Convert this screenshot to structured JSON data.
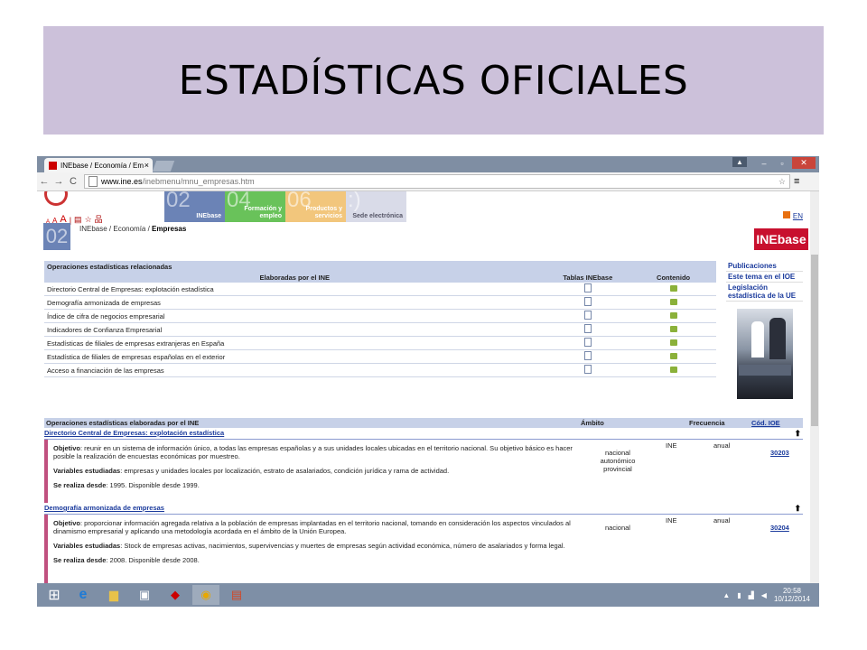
{
  "slide": {
    "title": "ESTADÍSTICAS OFICIALES"
  },
  "browser": {
    "tab_title": "INEbase / Economía / Em",
    "tab_close": "×",
    "url_host": "www.ine.es",
    "url_path": "/inebmenu/mnu_empresas.htm",
    "win_min": "–",
    "win_max": "▫",
    "win_close": "✕",
    "user": "▲",
    "back": "←",
    "forward": "→",
    "reload": "C",
    "star": "☆",
    "menu": "≡"
  },
  "site": {
    "sizes": [
      "A",
      "A",
      "A"
    ],
    "sections": [
      {
        "num": "02",
        "label": "INEbase"
      },
      {
        "num": "04",
        "label": "Formación y empleo"
      },
      {
        "num": "06",
        "label": "Productos y servicios"
      },
      {
        "num": ":)",
        "label": "Sede electrónica"
      }
    ],
    "lang": "EN",
    "crumb_num": "02",
    "breadcrumb_prefix": "INEbase / Economía / ",
    "breadcrumb_current": "Empresas",
    "logo": "INEbase"
  },
  "related": {
    "title": "Operaciones estadísticas relacionadas",
    "col_made_by": "Elaboradas por el INE",
    "col_tables": "Tablas INEbase",
    "col_content": "Contenido",
    "rows": [
      "Directorio Central de Empresas: explotación estadística",
      "Demografía armonizada de empresas",
      "Índice de cifra de negocios empresarial",
      "Indicadores de Confianza Empresarial",
      "Estadísticas de filiales de empresas extranjeras en España",
      "Estadística de filiales de empresas españolas en el exterior",
      "Acceso a financiación de las empresas"
    ]
  },
  "sidebar": {
    "links": [
      "Publicaciones",
      "Este tema en el IOE",
      "Legislación estadística de la UE"
    ]
  },
  "operations": {
    "header": "Operaciones estadísticas elaboradas por el INE",
    "col_ambito": "Ámbito",
    "col_frecuencia": "Frecuencia",
    "col_codigo": "Cód. IOE",
    "items": [
      {
        "title": "Directorio Central de Empresas: explotación estadística",
        "objetivo_label": "Objetivo",
        "objetivo": ": reunir en un sistema de información único, a todas las empresas españolas y a sus unidades locales ubicadas en el territorio nacional. Su objetivo básico es hacer posible la realización de encuestas económicas por muestreo.",
        "variables_label": "Variables estudiadas",
        "variables": ": empresas y unidades locales por localización, estrato de asalariados, condición jurídica y rama de actividad.",
        "realiza_label": "Se realiza desde",
        "realiza": ": 1995. Disponible desde 1999.",
        "ambito": "nacional autonómico provincial",
        "org": "INE",
        "frecuencia": "anual",
        "codigo": "30203"
      },
      {
        "title": "Demografía armonizada de empresas",
        "objetivo_label": "Objetivo",
        "objetivo": ": proporcionar información agregada relativa a la población de empresas implantadas en el territorio nacional, tomando en consideración los aspectos vinculados al dinamismo empresarial y aplicando una metodología acordada en el ámbito de la Unión Europea.",
        "variables_label": "Variables estudiadas",
        "variables": ": Stock de empresas activas, nacimientos, supervivencias y muertes de empresas según actividad económica, número de asalariados y forma legal.",
        "realiza_label": "Se realiza desde",
        "realiza": ": 2008. Disponible desde 2008.",
        "ambito": "nacional",
        "org": "INE",
        "frecuencia": "anual",
        "codigo": "30204"
      }
    ],
    "up_arrow": "⬆"
  },
  "taskbar": {
    "time": "20:58",
    "date": "10/12/2014",
    "tray_arrow": "▲"
  }
}
